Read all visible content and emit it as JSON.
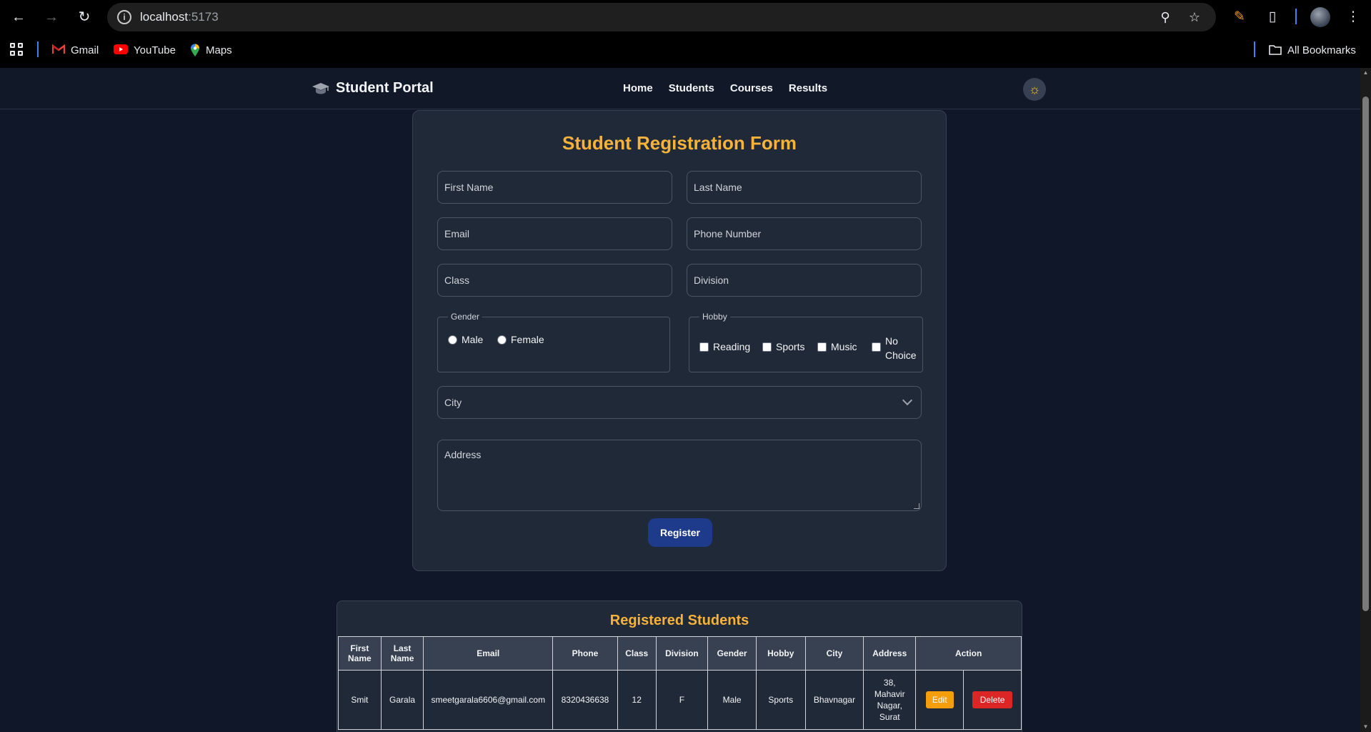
{
  "browser": {
    "url_host": "localhost",
    "url_port": ":5173",
    "bookmarks": [
      {
        "label": "Gmail",
        "icon": "gmail-icon"
      },
      {
        "label": "YouTube",
        "icon": "youtube-icon"
      },
      {
        "label": "Maps",
        "icon": "maps-icon"
      }
    ],
    "all_bookmarks": "All Bookmarks"
  },
  "navbar": {
    "brand": "Student Portal",
    "links": [
      "Home",
      "Students",
      "Courses",
      "Results"
    ],
    "theme_icon": "sun-icon"
  },
  "form": {
    "title": "Student Registration Form",
    "first_name_placeholder": "First Name",
    "last_name_placeholder": "Last Name",
    "email_placeholder": "Email",
    "phone_placeholder": "Phone Number",
    "class_placeholder": "Class",
    "division_placeholder": "Division",
    "gender_legend": "Gender",
    "gender_options": [
      "Male",
      "Female"
    ],
    "hobby_legend": "Hobby",
    "hobby_options": [
      "Reading",
      "Sports",
      "Music",
      "No Choice"
    ],
    "city_placeholder": "City",
    "address_placeholder": "Address",
    "register_label": "Register"
  },
  "table": {
    "title": "Registered Students",
    "headers": [
      "First Name",
      "Last Name",
      "Email",
      "Phone",
      "Class",
      "Division",
      "Gender",
      "Hobby",
      "City",
      "Address",
      "Action"
    ],
    "rows": [
      {
        "first_name": "Smit",
        "last_name": "Garala",
        "email": "smeetgarala6606@gmail.com",
        "phone": "8320436638",
        "class": "12",
        "division": "F",
        "gender": "Male",
        "hobby": "Sports",
        "city": "Bhavnagar",
        "address": "38, Mahavir Nagar, Surat",
        "edit_label": "Edit",
        "delete_label": "Delete"
      }
    ]
  },
  "colors": {
    "accent": "#f6b23a",
    "page_bg": "#0f1729",
    "card_bg": "#1f2937",
    "register_btn": "#1e3a8a",
    "edit_btn": "#f59e0b",
    "delete_btn": "#dc2626"
  }
}
